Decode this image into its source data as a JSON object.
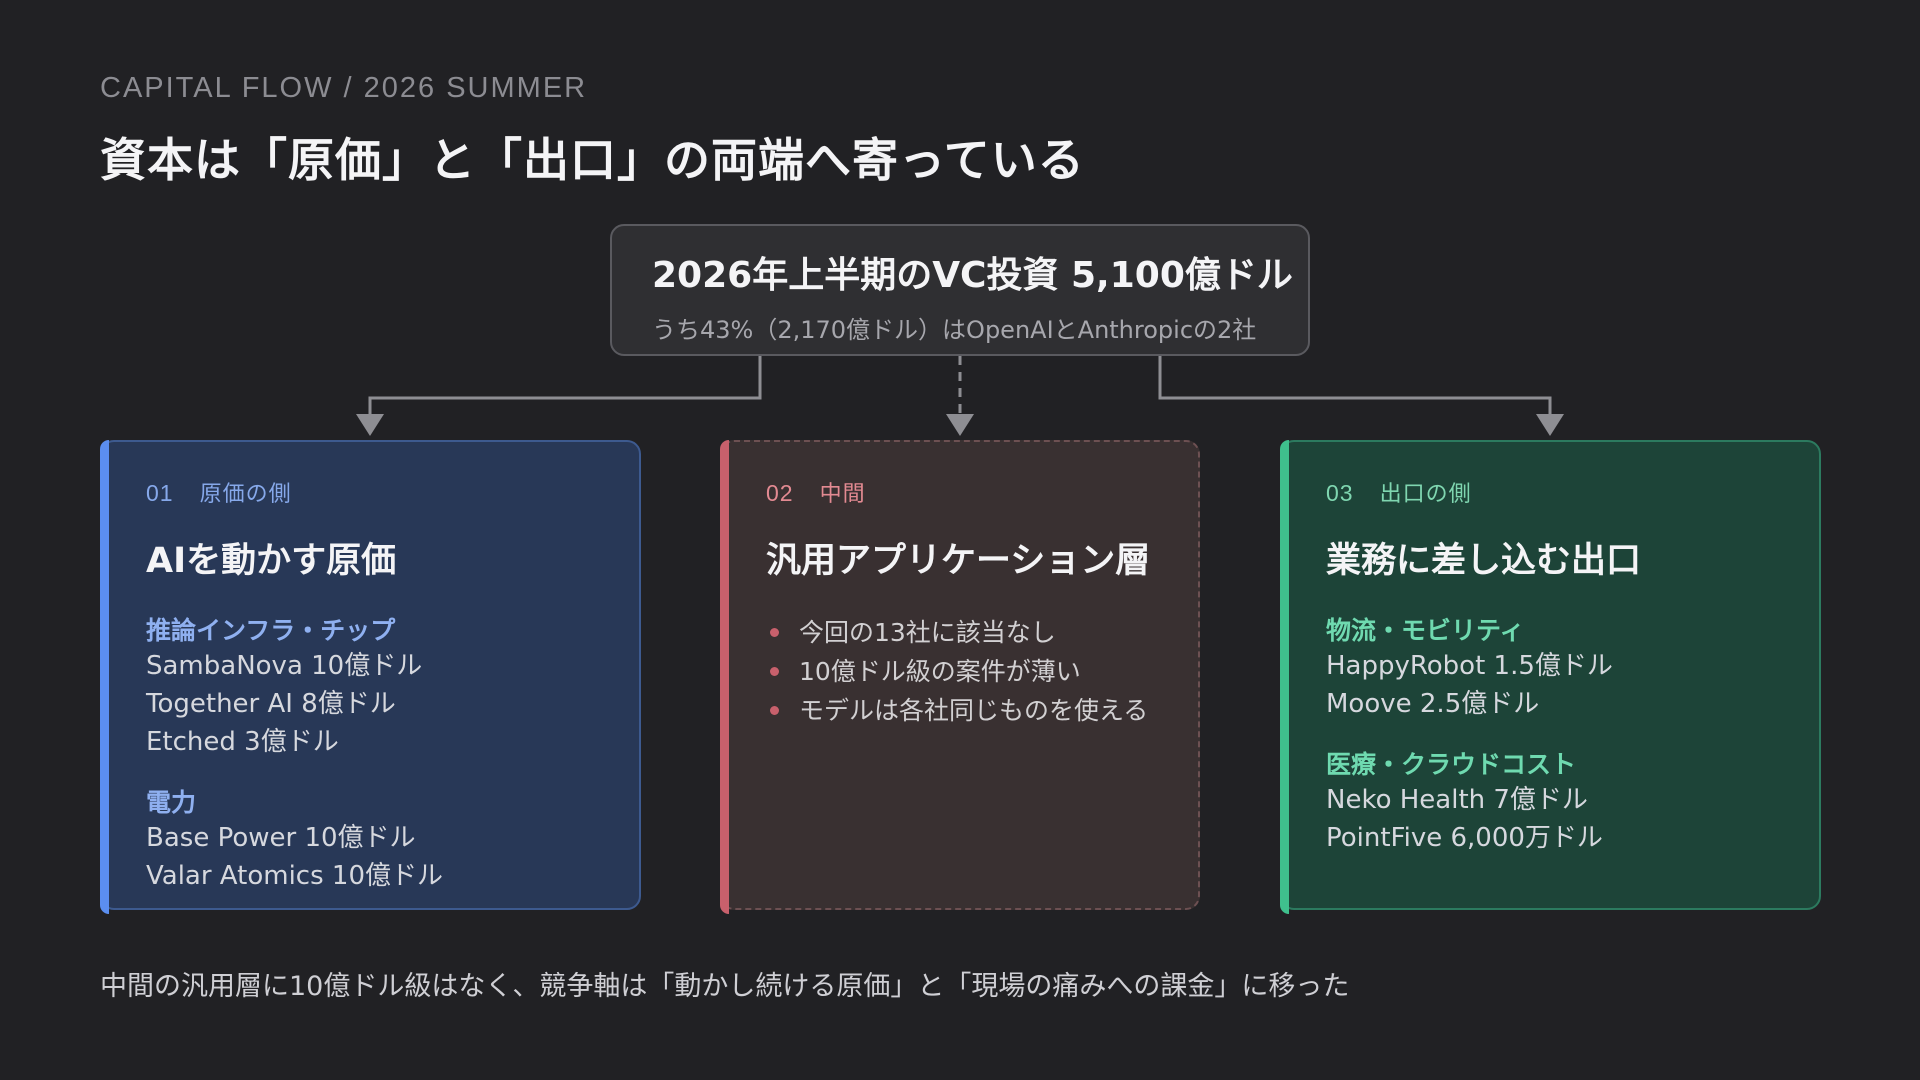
{
  "header": {
    "eyebrow": "CAPITAL FLOW / 2026 SUMMER",
    "title": "資本は「原価」と「出口」の両端へ寄っている"
  },
  "root": {
    "main": "2026年上半期のVC投資 5,100億ドル",
    "sub": "うち43%（2,170億ドル）はOpenAIとAnthropicの2社"
  },
  "cards": [
    {
      "num": "01",
      "tag": "原価の側",
      "title": "AIを動かす原価",
      "groups": [
        {
          "head": "推論インフラ・チップ",
          "items": [
            "SambaNova 10億ドル",
            "Together AI 8億ドル",
            "Etched 3億ドル"
          ]
        },
        {
          "head": "電力",
          "items": [
            "Base Power 10億ドル",
            "Valar Atomics 10億ドル"
          ]
        }
      ]
    },
    {
      "num": "02",
      "tag": "中間",
      "title": "汎用アプリケーション層",
      "bullets": [
        "今回の13社に該当なし",
        "10億ドル級の案件が薄い",
        "モデルは各社同じものを使える"
      ]
    },
    {
      "num": "03",
      "tag": "出口の側",
      "title": "業務に差し込む出口",
      "groups": [
        {
          "head": "物流・モビリティ",
          "items": [
            "HappyRobot 1.5億ドル",
            "Moove 2.5億ドル"
          ]
        },
        {
          "head": "医療・クラウドコスト",
          "items": [
            "Neko Health 7億ドル",
            "PointFive 6,000万ドル"
          ]
        }
      ]
    }
  ],
  "footer": "中間の汎用層に10億ドル級はなく、競争軸は「動かし続ける原価」と「現場の痛みへの課金」に移った",
  "colors": {
    "background": "#212124",
    "blue_accent": "#5b8ef0",
    "red_accent": "#c8606c",
    "green_accent": "#3fc08d",
    "connector": "#8e8e93"
  }
}
